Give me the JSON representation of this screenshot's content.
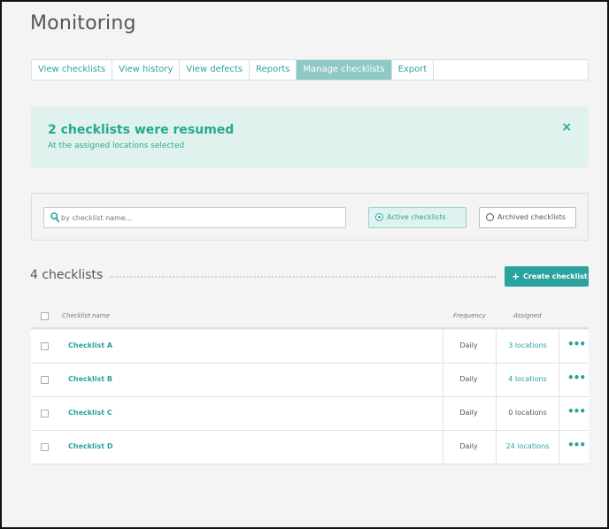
{
  "page": {
    "title": "Monitoring"
  },
  "tabs": [
    {
      "label": "View checklists",
      "active": false
    },
    {
      "label": "View history",
      "active": false
    },
    {
      "label": "View defects",
      "active": false
    },
    {
      "label": "Reports",
      "active": false
    },
    {
      "label": "Manage checklists",
      "active": true
    },
    {
      "label": "Export",
      "active": false
    }
  ],
  "banner": {
    "title": "2 checklists were resumed",
    "subtitle": "At the assigned locations selected",
    "close_icon": "×"
  },
  "filter": {
    "search_placeholder": "by checklist name...",
    "active_label": "Active checklists",
    "archived_label": "Archived checklists",
    "selected": "active"
  },
  "list": {
    "count_label": "4 checklists",
    "create_label": "Create checklist",
    "create_icon": "+"
  },
  "table": {
    "headers": {
      "name": "Checklist name",
      "frequency": "Frequency",
      "assigned": "Assigned"
    },
    "more_icon": "•••",
    "rows": [
      {
        "name": "Checklist A",
        "frequency": "Daily",
        "assigned": "3 locations",
        "assigned_link": true
      },
      {
        "name": "Checklist B",
        "frequency": "Daily",
        "assigned": "4 locations",
        "assigned_link": true
      },
      {
        "name": "Checklist C",
        "frequency": "Daily",
        "assigned": "0 locations",
        "assigned_link": false
      },
      {
        "name": "Checklist D",
        "frequency": "Daily",
        "assigned": "24 locations",
        "assigned_link": true
      }
    ]
  },
  "colors": {
    "accent": "#2aa3a0",
    "active_tab_bg": "#8ec9c7",
    "banner_bg": "#dff2ee",
    "banner_text": "#27a88f",
    "page_bg": "#f4f4f4"
  }
}
